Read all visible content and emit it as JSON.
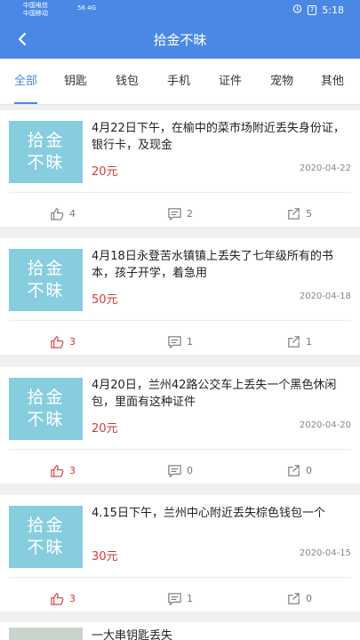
{
  "status_bar": {
    "carrier1": "中国电信",
    "carrier2": "中国移动",
    "network": "56 4G",
    "battery": "7",
    "time": "5:18"
  },
  "header": {
    "title": "拾金不昧"
  },
  "tabs": [
    {
      "label": "全部",
      "active": true
    },
    {
      "label": "钥匙"
    },
    {
      "label": "钱包"
    },
    {
      "label": "手机"
    },
    {
      "label": "证件"
    },
    {
      "label": "宠物"
    },
    {
      "label": "其他"
    }
  ],
  "thumb_label": {
    "line1": "拾金",
    "line2": "不昧"
  },
  "posts": [
    {
      "desc": "4月22日下午，在榆中的菜市场附近丢失身份证，银行卡，及现金",
      "price": "20元",
      "date": "2020-04-22",
      "likes": "4",
      "comments": "2",
      "shares": "5",
      "liked": false
    },
    {
      "desc": "4月18日永登苦水镇镇上丢失了七年级所有的书本，孩子开学，着急用",
      "price": "50元",
      "date": "2020-04-18",
      "likes": "3",
      "comments": "1",
      "shares": "1",
      "liked": true
    },
    {
      "desc": "4月20日，兰州42路公交车上丢失一个黑色休闲包，里面有这种证件",
      "price": "20元",
      "date": "2020-04-20",
      "likes": "3",
      "comments": "0",
      "shares": "0",
      "liked": true
    },
    {
      "desc": "4.15日下午，兰州中心附近丢失棕色钱包一个",
      "price": "30元",
      "date": "2020-04-15",
      "likes": "3",
      "comments": "1",
      "shares": "0",
      "liked": true
    },
    {
      "desc": "一大串钥匙丢失"
    }
  ],
  "colors": {
    "primary": "#4a88e6",
    "thumb_bg": "#86cde0",
    "price": "#d23a3a"
  }
}
